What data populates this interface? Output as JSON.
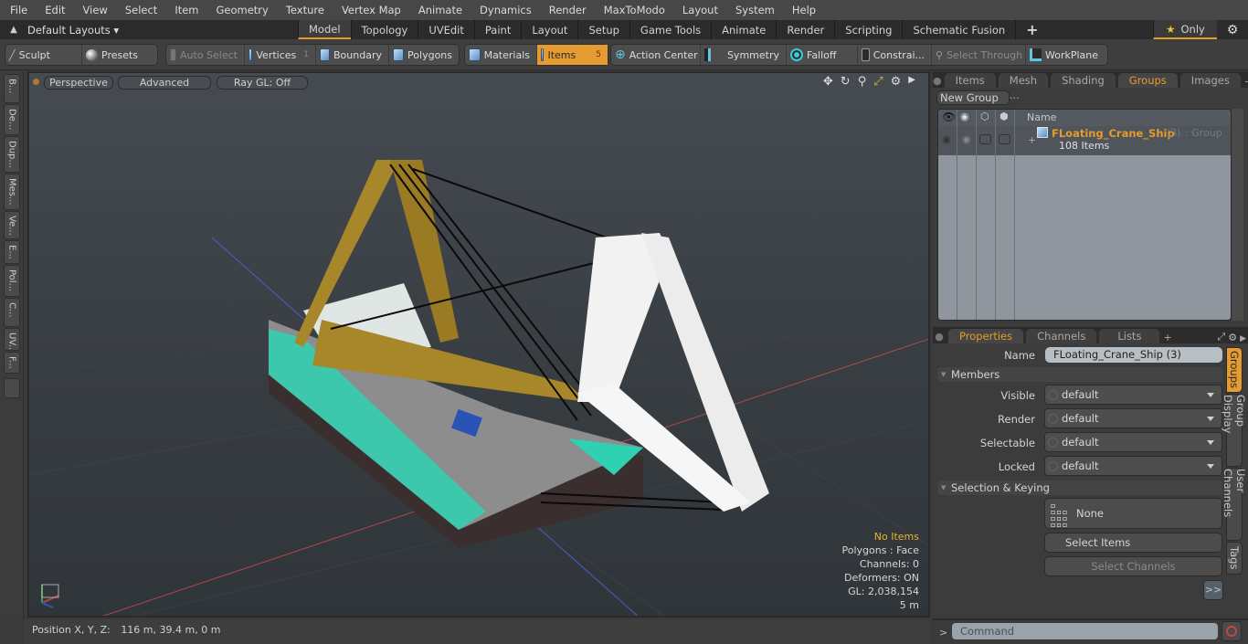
{
  "menubar": {
    "items": [
      "File",
      "Edit",
      "View",
      "Select",
      "Item",
      "Geometry",
      "Texture",
      "Vertex Map",
      "Animate",
      "Dynamics",
      "Render",
      "MaxToModo",
      "Layout",
      "System",
      "Help"
    ]
  },
  "layoutbar": {
    "layouts_label": "Default Layouts ▾",
    "tabs": [
      "Model",
      "Topology",
      "UVEdit",
      "Paint",
      "Layout",
      "Setup",
      "Game Tools",
      "Animate",
      "Render",
      "Scripting",
      "Schematic Fusion"
    ],
    "active_tab": "Model",
    "add_label": "+",
    "only_label": "Only"
  },
  "toolbar": {
    "sculpt": "Sculpt",
    "presets": "Presets",
    "auto_select": "Auto Select",
    "vertices": "Vertices",
    "vertices_count": "1",
    "boundary": "Boundary",
    "polygons": "Polygons",
    "materials": "Materials",
    "items": "Items",
    "items_count": "5",
    "action_center": "Action Center",
    "symmetry": "Symmetry",
    "falloff": "Falloff",
    "constraints": "Constrai...",
    "select_through": "Select Through",
    "workplane": "WorkPlane"
  },
  "left_tabs": [
    "B...",
    "De...",
    "Dup...",
    "Mes...",
    "Ve...",
    "E...",
    "Pol...",
    "C...",
    "UV...",
    "F..."
  ],
  "viewport": {
    "view_mode": "Perspective",
    "shading": "Advanced",
    "raygl": "Ray GL: Off",
    "hud": {
      "selection": "No Items",
      "polygons": "Polygons : Face",
      "channels": "Channels: 0",
      "deformers": "Deformers: ON",
      "gl": "GL: 2,038,154",
      "scale": "5 m"
    },
    "colors": {
      "hull_accent": "#2fd1b2",
      "crane_gold": "#a8862a",
      "crane_white": "#f2f2f2",
      "x_axis": "#b04848",
      "z_axis": "#4a5fc0"
    }
  },
  "statusbar": {
    "position_label": "Position X, Y, Z:",
    "position_value": "116 m, 39.4 m, 0 m"
  },
  "groups_panel": {
    "tabs": [
      "Items",
      "Mesh ...",
      "Shading",
      "Groups",
      "Images"
    ],
    "active_tab": "Groups",
    "new_group": "New Group",
    "column_name": "Name",
    "group": {
      "name": "FLoating_Crane_Ship",
      "count": "(3)",
      "type": ": Group",
      "items": "108 Items"
    }
  },
  "properties_panel": {
    "tabs": [
      "Properties",
      "Channels",
      "Lists"
    ],
    "active_tab": "Properties",
    "name_label": "Name",
    "name_value": "FLoating_Crane_Ship (3)",
    "members_header": "Members",
    "fields": [
      {
        "label": "Visible",
        "value": "default"
      },
      {
        "label": "Render",
        "value": "default"
      },
      {
        "label": "Selectable",
        "value": "default"
      },
      {
        "label": "Locked",
        "value": "default"
      }
    ],
    "selection_header": "Selection & Keying",
    "none_label": "None",
    "select_items": "Select Items",
    "select_channels": "Select Channels",
    "more": ">>",
    "side_tabs": [
      "Groups",
      "Group Display",
      "User Channels",
      "Tags"
    ]
  },
  "command": {
    "placeholder": "Command",
    "prompt": ">"
  },
  "accent": "#e59b2f"
}
